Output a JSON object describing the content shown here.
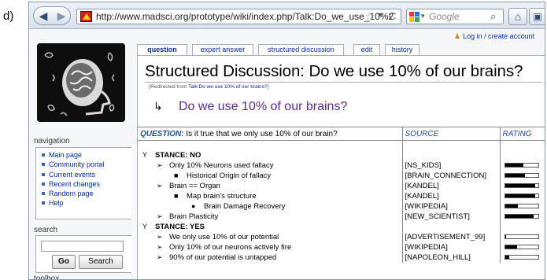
{
  "figure_label": "d)",
  "browser": {
    "url": "http://www.madsci.org/prototype/wiki/index.php/Talk:Do_we_use_10%2",
    "search_placeholder": "Google",
    "icons": [
      "back-arrow-icon",
      "forward-arrow-icon",
      "favicon",
      "bookmark-star-icon",
      "reload-icon",
      "google-icon",
      "search-icon",
      "home-icon",
      "extension-icon"
    ]
  },
  "user": {
    "login_text": "Log in / create account"
  },
  "tabs": [
    {
      "label": "question",
      "selected": true
    },
    {
      "label": "expert answer",
      "selected": false
    },
    {
      "label": "structured discussion",
      "selected": false
    },
    {
      "label": "edit",
      "selected": false
    },
    {
      "label": "history",
      "selected": false
    }
  ],
  "sidebar": {
    "navigation_heading": "navigation",
    "nav_items": [
      {
        "label": "Main page"
      },
      {
        "label": "Community portal"
      },
      {
        "label": "Current events"
      },
      {
        "label": "Recent changes"
      },
      {
        "label": "Random page"
      },
      {
        "label": "Help"
      }
    ],
    "search_heading": "search",
    "go_label": "Go",
    "search_button_label": "Search",
    "toolbox_heading": "toolbox"
  },
  "page": {
    "title": "Structured Discussion: Do we use 10% of our brains?",
    "redirect_prefix": "(Redirected from ",
    "redirect_link": "Talk:Do we use 10% of our brains?",
    "redirect_suffix": ")",
    "subheading": "Do we use 10% of our brains?"
  },
  "table": {
    "question_label": "QUESTION:",
    "question_text": " Is it true that we only use 10% of our brain?",
    "source_header": "SOURCE",
    "rating_header": "RATING",
    "rows": [
      {
        "kind": "stance",
        "marker": "Y",
        "prefix": "STANCE:",
        "text": " NO",
        "source": "",
        "rating": null
      },
      {
        "kind": "item",
        "level": 1,
        "marker": "➢",
        "text": "Only 10% Neurons used fallacy",
        "source": "[NS_KIDS]",
        "rating": 0.55
      },
      {
        "kind": "item",
        "level": 2,
        "marker": "■",
        "text": "Historical Origin of fallacy",
        "source": "[BRAIN_CONNECTION]",
        "rating": 0.6
      },
      {
        "kind": "item",
        "level": 1,
        "marker": "➢",
        "text": "Brain == Organ",
        "source": "[KANDEL]",
        "rating": 0.92
      },
      {
        "kind": "item",
        "level": 2,
        "marker": "■",
        "text": "Map brain’s structure",
        "source": "[KANDEL]",
        "rating": 0.92
      },
      {
        "kind": "item",
        "level": 3,
        "marker": "●",
        "text": "Brain Damage Recovery",
        "source": "[WIKIPEDIA]",
        "rating": 0.4
      },
      {
        "kind": "item",
        "level": 1,
        "marker": "➢",
        "text": "Brain Plasticity",
        "source": "[NEW_SCIENTIST]",
        "rating": 0.88
      },
      {
        "kind": "stance",
        "marker": "Y",
        "prefix": "STANCE:",
        "text": " YES",
        "source": "",
        "rating": null
      },
      {
        "kind": "item",
        "level": 1,
        "marker": "➢",
        "text": "We only use 10% of our potential",
        "source": "[ADVERTISEMENT_99]",
        "rating": 0.04
      },
      {
        "kind": "item",
        "level": 1,
        "marker": "➢",
        "text": "Only 10% of our neurons actively fire",
        "source": "[WIKIPEDIA]",
        "rating": 0.38
      },
      {
        "kind": "item",
        "level": 1,
        "marker": "➢",
        "text": "90% of our potential is untapped",
        "source": "[NAPOLEON_HILL]",
        "rating": 0.14
      }
    ]
  }
}
